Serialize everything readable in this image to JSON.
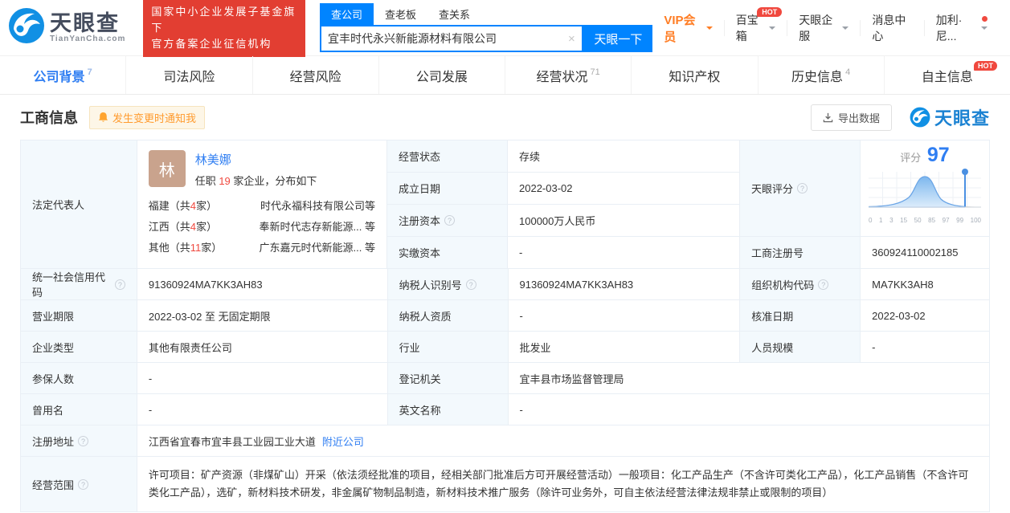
{
  "colors": {
    "accent_blue": "#0084ff",
    "link_blue": "#2f7ef2",
    "brand_red": "#e23e32",
    "hot_red": "#f0483e",
    "orange": "#ff9b2e",
    "vip_orange": "#ff7d24",
    "label_bg": "#f3f9fd",
    "score_blue": "#2f7ef2"
  },
  "header": {
    "logo": {
      "title": "天眼查",
      "subtitle": "TianYanCha.com"
    },
    "badge": {
      "line1": "国家中小企业发展子基金旗下",
      "line2": "官方备案企业征信机构"
    },
    "search": {
      "tabs": [
        {
          "label": "查公司"
        },
        {
          "label": "查老板"
        },
        {
          "label": "查关系"
        }
      ],
      "value": "宜丰时代永兴新能源材料有限公司",
      "button": "天眼一下"
    },
    "menu": {
      "vip": "VIP会员",
      "toolbox": "百宝箱",
      "toolbox_badge": "HOT",
      "enterprise": "天眼企服",
      "messages": "消息中心",
      "user": "加利·尼..."
    }
  },
  "nav": {
    "tabs": [
      {
        "label": "公司背景",
        "count": "7"
      },
      {
        "label": "司法风险"
      },
      {
        "label": "经营风险"
      },
      {
        "label": "公司发展"
      },
      {
        "label": "经营状况",
        "count": "71"
      },
      {
        "label": "知识产权"
      },
      {
        "label": "历史信息",
        "count": "4"
      },
      {
        "label": "自主信息",
        "badge": "HOT"
      }
    ]
  },
  "section": {
    "title": "工商信息",
    "notify": "发生变更时通知我",
    "export": "导出数据",
    "watermark_title": "天眼查"
  },
  "table": {
    "legal_rep": {
      "label": "法定代表人",
      "avatar_char": "林",
      "name": "林美娜",
      "tenure_prefix": "任职 ",
      "tenure_count": "19",
      "tenure_suffix": " 家企业，分布如下",
      "distribution": [
        {
          "region_prefix": "福建（共",
          "count": "4",
          "region_suffix": "家）",
          "companies": "时代永福科技有限公司等"
        },
        {
          "region_prefix": "江西（共",
          "count": "4",
          "region_suffix": "家）",
          "companies": "奉新时代志存新能源...  等"
        },
        {
          "region_prefix": "其他（共",
          "count": "11",
          "region_suffix": "家）",
          "companies": "广东嘉元时代新能源...  等"
        }
      ]
    },
    "status": {
      "label": "经营状态",
      "value": "存续"
    },
    "established": {
      "label": "成立日期",
      "value": "2022-03-02"
    },
    "reg_capital": {
      "label": "注册资本",
      "value": "100000万人民币"
    },
    "paid_capital": {
      "label": "实缴资本",
      "value": "-"
    },
    "score": {
      "label": "天眼评分",
      "score_label": "评分",
      "score": "97",
      "axis": [
        "0",
        "1",
        "3",
        "15",
        "50",
        "85",
        "97",
        "99",
        "100"
      ]
    },
    "reg_number": {
      "label": "工商注册号",
      "value": "360924110002185"
    },
    "credit_code": {
      "label": "统一社会信用代码",
      "value": "91360924MA7KK3AH83"
    },
    "taxpayer_id": {
      "label": "纳税人识别号",
      "value": "91360924MA7KK3AH83"
    },
    "org_code": {
      "label": "组织机构代码",
      "value": "MA7KK3AH8"
    },
    "business_term": {
      "label": "营业期限",
      "value": "2022-03-02 至 无固定期限"
    },
    "taxpayer_quality": {
      "label": "纳税人资质",
      "value": "-"
    },
    "approval_date": {
      "label": "核准日期",
      "value": "2022-03-02"
    },
    "company_type": {
      "label": "企业类型",
      "value": "其他有限责任公司"
    },
    "industry": {
      "label": "行业",
      "value": "批发业"
    },
    "staff_size": {
      "label": "人员规模",
      "value": "-"
    },
    "insured_count": {
      "label": "参保人数",
      "value": "-"
    },
    "registry": {
      "label": "登记机关",
      "value": "宜丰县市场监督管理局"
    },
    "former_name": {
      "label": "曾用名",
      "value": "-"
    },
    "english_name": {
      "label": "英文名称",
      "value": "-"
    },
    "address": {
      "label": "注册地址",
      "value": "江西省宜春市宜丰县工业园工业大道",
      "link": "附近公司"
    },
    "business_scope": {
      "label": "经营范围",
      "value": "许可项目：矿产资源（非煤矿山）开采（依法须经批准的项目，经相关部门批准后方可开展经营活动）一般项目：化工产品生产（不含许可类化工产品），化工产品销售（不含许可类化工产品），选矿，新材料技术研发，非金属矿物制品制造，新材料技术推广服务（除许可业务外，可自主依法经营法律法规非禁止或限制的项目）"
    }
  }
}
